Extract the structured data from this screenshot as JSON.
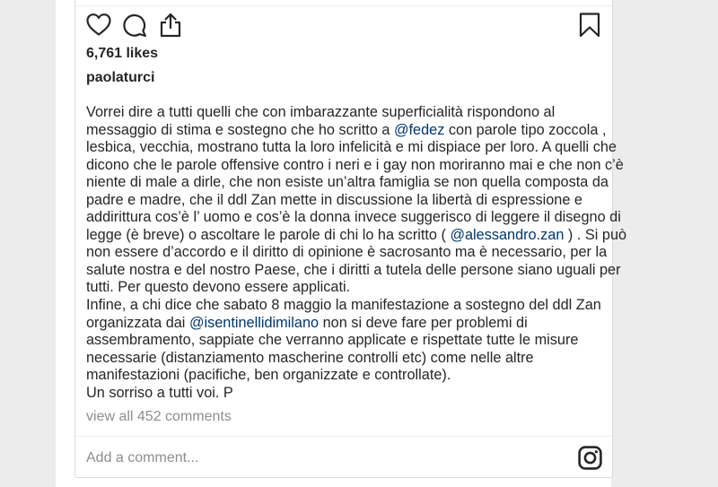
{
  "post": {
    "likes": "6,761 likes",
    "username": "paolaturci",
    "caption": [
      [
        {
          "t": "Vorrei dire a tutti quelli che con imbarazzante superficialità rispondono al"
        }
      ],
      [
        {
          "t": "messaggio di stima e sostegno che ho scritto a "
        },
        {
          "t": "@fedez",
          "m": true
        },
        {
          "t": " con parole tipo zoccola ,"
        }
      ],
      [
        {
          "t": "lesbica, vecchia, mostrano tutta la loro infelicità e mi dispiace per loro. A quelli che"
        }
      ],
      [
        {
          "t": "dicono che le parole offensive contro i neri e i gay non moriranno mai e che non c’è"
        }
      ],
      [
        {
          "t": "niente di male a dirle, che non esiste un’altra famiglia se non quella composta da"
        }
      ],
      [
        {
          "t": "padre e madre, che il ddl Zan mette in discussione la libertà di espressione e"
        }
      ],
      [
        {
          "t": "addirittura cos’è l’ uomo e cos’è la donna invece suggerisco di leggere il disegno di"
        }
      ],
      [
        {
          "t": "legge (è breve) o ascoltare le parole di chi lo ha scritto ( "
        },
        {
          "t": "@alessandro.zan",
          "m": true
        },
        {
          "t": " ) . Si può"
        }
      ],
      [
        {
          "t": "non essere d’accordo e il diritto di opinione è sacrosanto ma è necessario, per la"
        }
      ],
      [
        {
          "t": "salute nostra e del nostro Paese, che i diritti a tutela delle persone siano uguali per"
        }
      ],
      [
        {
          "t": "tutti. Per questo devono essere applicati."
        }
      ],
      [
        {
          "t": "Infine, a chi dice che sabato 8 maggio la manifestazione a sostegno del ddl Zan"
        }
      ],
      [
        {
          "t": "organizzata dai "
        },
        {
          "t": "@isentinellidimilano",
          "m": true
        },
        {
          "t": " non si deve fare per problemi di"
        }
      ],
      [
        {
          "t": "assembramento, sappiate che verranno applicate e rispettate tutte le misure"
        }
      ],
      [
        {
          "t": "necessarie (distanziamento mascherine controlli etc) come nelle altre"
        }
      ],
      [
        {
          "t": "manifestazioni (pacifiche, ben organizzate e controllate)."
        }
      ],
      [
        {
          "t": "Un sorriso a tutti voi. P"
        }
      ]
    ],
    "view_all_comments": "view all 452 comments",
    "comment_placeholder": "Add a comment..."
  },
  "icons": {
    "like": "heart-icon",
    "comment": "comment-icon",
    "share": "share-icon",
    "save": "bookmark-icon",
    "brand": "instagram-icon"
  },
  "colors": {
    "text": "#262626",
    "mention": "#00376b",
    "muted": "#8e8e8e",
    "border": "#dbdbdb"
  }
}
